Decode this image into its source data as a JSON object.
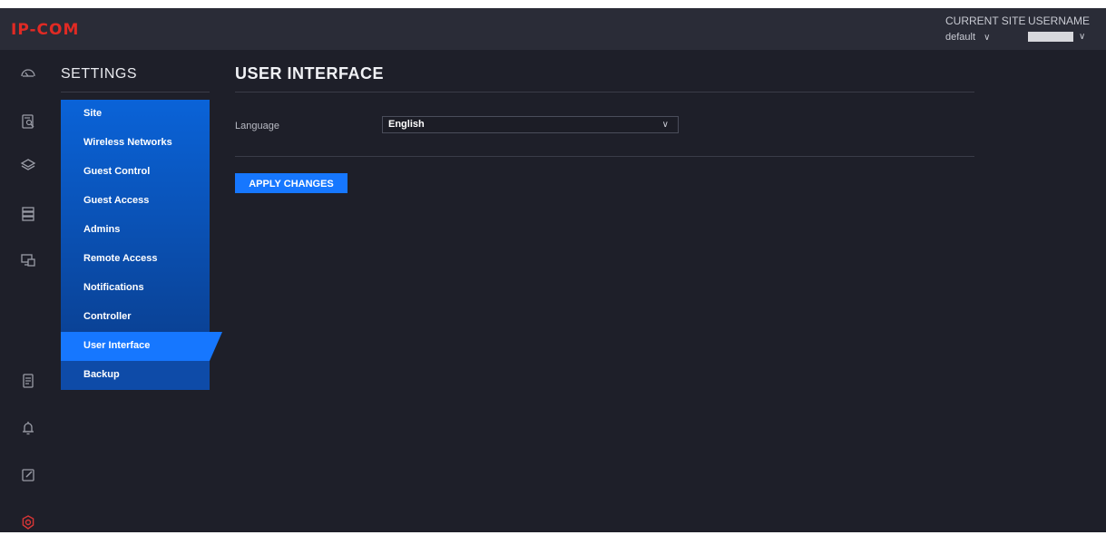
{
  "header": {
    "logo_text": "IP-COM",
    "current_site_label": "CURRENT SITE",
    "current_site_value": "default",
    "username_label": "USERNAME",
    "chevron": "∨"
  },
  "icons": {
    "dashboard": "gauge-icon",
    "log": "document-search-icon",
    "layers": "layers-icon",
    "devices": "server-icon",
    "clients": "screens-icon",
    "notes": "notepad-icon",
    "alerts": "bell-icon",
    "edit": "edit-icon",
    "settings": "gear-icon"
  },
  "colors": {
    "accent": "#1677ff",
    "logo": "#e02a24",
    "settings_icon_active": "#d93636",
    "background": "#1e1f29"
  },
  "sidebar": {
    "title": "SETTINGS",
    "items": [
      {
        "label": "Site"
      },
      {
        "label": "Wireless Networks"
      },
      {
        "label": "Guest Control"
      },
      {
        "label": "Guest Access"
      },
      {
        "label": "Admins"
      },
      {
        "label": "Remote Access"
      },
      {
        "label": "Notifications"
      },
      {
        "label": "Controller"
      },
      {
        "label": "User Interface"
      },
      {
        "label": "Backup"
      }
    ],
    "active_item": "User Interface"
  },
  "main": {
    "title": "USER INTERFACE",
    "language_label": "Language",
    "language_value": "English",
    "apply_label": "APPLY CHANGES"
  }
}
